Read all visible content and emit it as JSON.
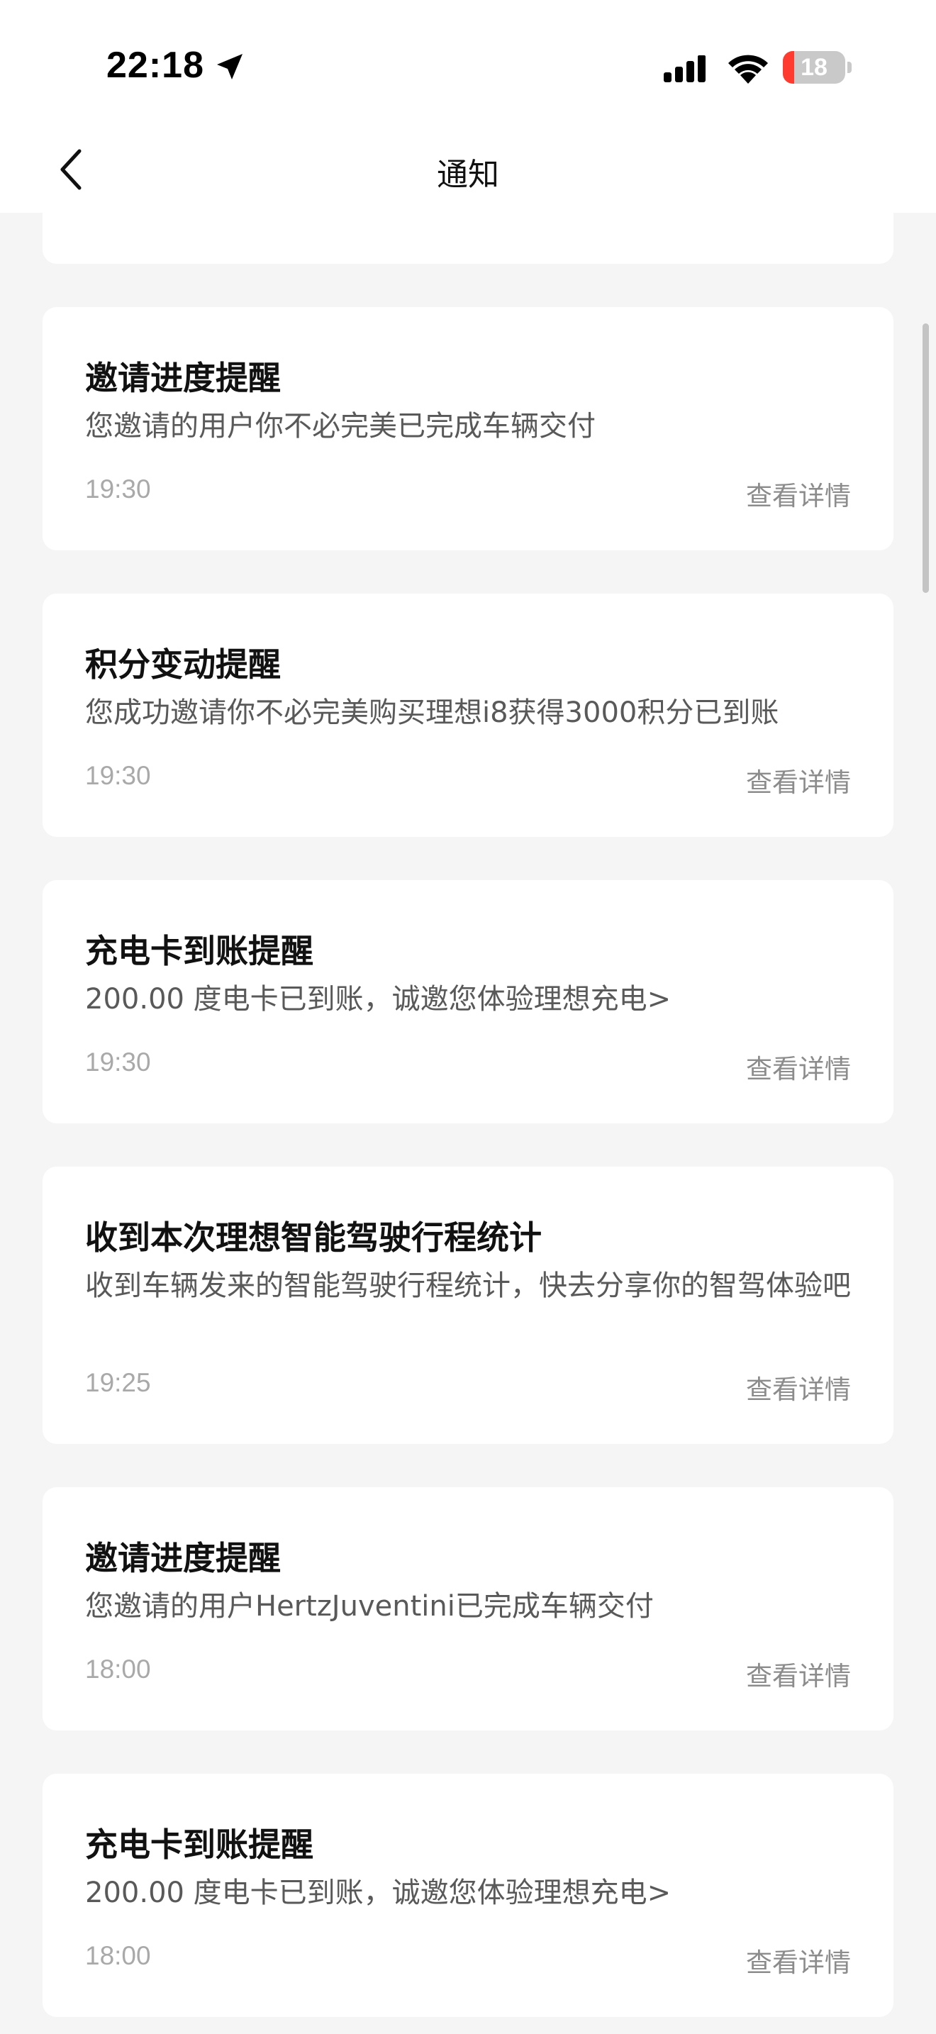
{
  "status_bar": {
    "time": "22:18",
    "battery_level": "18",
    "battery_fraction": 0.18,
    "icons": [
      "location-arrow-icon",
      "cellular-signal-icon",
      "wifi-icon",
      "battery-icon"
    ]
  },
  "nav": {
    "back_icon": "chevron-left-icon",
    "title": "通知"
  },
  "colors": {
    "background": "#f5f5f5",
    "card": "#ffffff",
    "title_text": "#111111",
    "body_text": "#595959",
    "meta_text": "#a9a9a9",
    "battery_low": "#ff3b30"
  },
  "notifications": [
    {
      "title": "邀请进度提醒",
      "body": "您邀请的用户你不必完美已完成车辆交付",
      "time": "19:30",
      "action": "查看详情"
    },
    {
      "title": "积分变动提醒",
      "body": "您成功邀请你不必完美购买理想i8获得3000积分已到账",
      "time": "19:30",
      "action": "查看详情"
    },
    {
      "title": "充电卡到账提醒",
      "body": "200.00 度电卡已到账，诚邀您体验理想充电>",
      "time": "19:30",
      "action": "查看详情"
    },
    {
      "title": "收到本次理想智能驾驶行程统计",
      "body": "收到车辆发来的智能驾驶行程统计，快去分享你的智驾体验吧",
      "time": "19:25",
      "action": "查看详情"
    },
    {
      "title": "邀请进度提醒",
      "body": "您邀请的用户HertzJuventini已完成车辆交付",
      "time": "18:00",
      "action": "查看详情"
    },
    {
      "title": "充电卡到账提醒",
      "body": "200.00 度电卡已到账，诚邀您体验理想充电>",
      "time": "18:00",
      "action": "查看详情"
    }
  ]
}
